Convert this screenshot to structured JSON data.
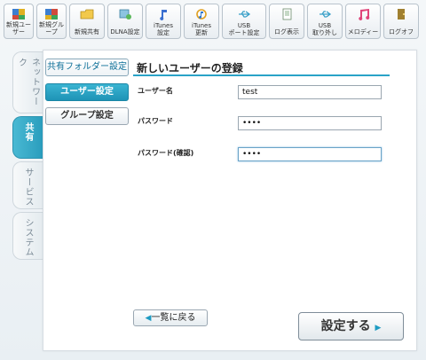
{
  "toolbar": {
    "items": [
      {
        "label": "新規ユーザー",
        "icon": "users-icon"
      },
      {
        "label": "新規グループ",
        "icon": "group-icon"
      },
      {
        "label": "新規共有",
        "icon": "folder-icon"
      },
      {
        "label": "DLNA設定",
        "icon": "media-server-icon"
      },
      {
        "label": "iTunes\n設定",
        "icon": "music-note-icon"
      },
      {
        "label": "iTunes\n更新",
        "icon": "refresh-music-icon"
      },
      {
        "label": "USB\nポート設定",
        "icon": "usb-icon"
      },
      {
        "label": "ログ表示",
        "icon": "document-icon"
      },
      {
        "label": "USB\n取り外し",
        "icon": "usb-remove-icon"
      },
      {
        "label": "メロディー",
        "icon": "melody-icon"
      },
      {
        "label": "ログオフ",
        "icon": "logoff-icon"
      }
    ]
  },
  "side_tabs": [
    {
      "label": "ネットワーク",
      "active": false
    },
    {
      "label": "共有",
      "active": true
    },
    {
      "label": "サービス",
      "active": false
    },
    {
      "label": "システム",
      "active": false
    }
  ],
  "submenu": {
    "shared_folder": "共有フォルダー設定",
    "user_settings": "ユーザー設定",
    "group_settings": "グループ設定"
  },
  "form": {
    "title": "新しいユーザーの登録",
    "username_label": "ユーザー名",
    "username_value": "test",
    "password_label": "パスワード",
    "password_value": "••••",
    "password_confirm_label": "パスワード(確認)",
    "password_confirm_value": "••••"
  },
  "actions": {
    "back": "一覧に戻る",
    "save": "設定する"
  },
  "colors": {
    "accent": "#2aa3c7",
    "active_tab": "#2a9dbd"
  }
}
